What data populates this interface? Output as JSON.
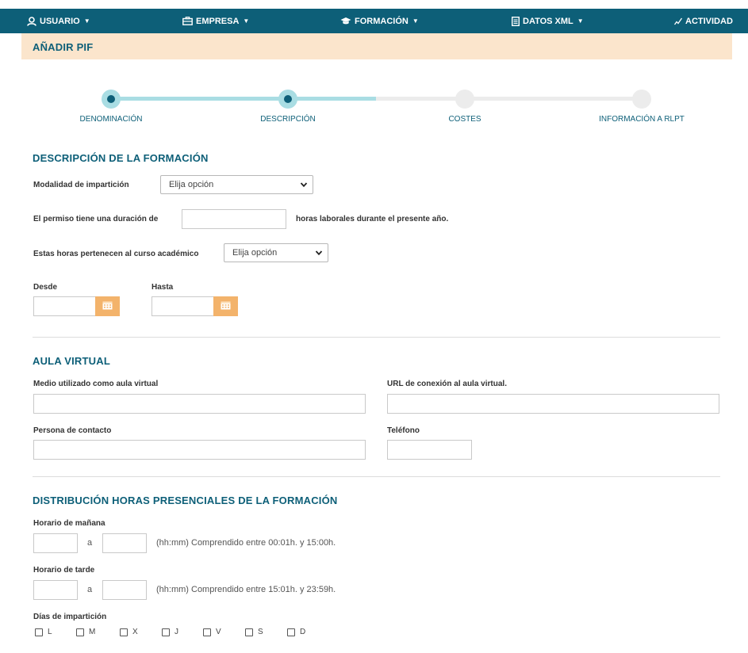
{
  "nav": {
    "usuario": "USUARIO",
    "empresa": "EMPRESA",
    "formacion": "FORMACIÓN",
    "datos_xml": "DATOS XML",
    "actividad": "ACTIVIDAD"
  },
  "page_title": "AÑADIR PIF",
  "steps": [
    {
      "label": "DENOMINACIÓN",
      "state": "active"
    },
    {
      "label": "DESCRIPCIÓN",
      "state": "active"
    },
    {
      "label": "COSTES",
      "state": "inactive"
    },
    {
      "label": "INFORMACIÓN A RLPT",
      "state": "inactive"
    }
  ],
  "descripcion": {
    "title": "DESCRIPCIÓN DE LA FORMACIÓN",
    "modalidad_label": "Modalidad de impartición",
    "modalidad_value": "Elija opción",
    "permiso_label": "El permiso tiene una duración de",
    "permiso_suffix": "horas laborales durante el presente año.",
    "curso_label": "Estas horas pertenecen al curso académico",
    "curso_value": "Elija opción",
    "desde_label": "Desde",
    "hasta_label": "Hasta"
  },
  "aula": {
    "title": "AULA VIRTUAL",
    "medio_label": "Medio utilizado como aula virtual",
    "url_label": "URL de conexión al aula virtual.",
    "contacto_label": "Persona de contacto",
    "telefono_label": "Teléfono"
  },
  "distribucion": {
    "title": "DISTRIBUCIÓN HORAS PRESENCIALES DE LA FORMACIÓN",
    "manana_label": "Horario de mañana",
    "tarde_label": "Horario de tarde",
    "a_text": "a",
    "manana_hint": "(hh:mm) Comprendido entre 00:01h. y 15:00h.",
    "tarde_hint": "(hh:mm) Comprendido entre 15:01h. y 23:59h.",
    "dias_label": "Días de impartición",
    "dias": [
      "L",
      "M",
      "X",
      "J",
      "V",
      "S",
      "D"
    ]
  },
  "colors": {
    "primary": "#0d5f78",
    "header_bg": "#fbe5cc",
    "step_active": "#a9dde3",
    "calendar_button": "#f3b36b"
  }
}
